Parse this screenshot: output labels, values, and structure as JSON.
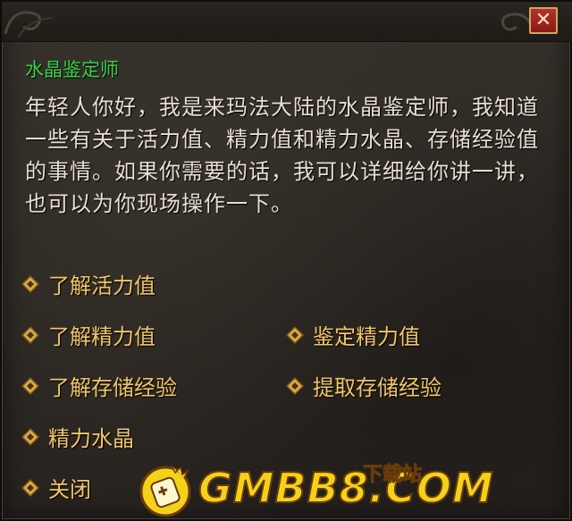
{
  "npc": {
    "name": "水晶鉴定师",
    "dialog": "年轻人你好，我是来玛法大陆的水晶鉴定师，我知道一些有关于活力值、精力值和精力水晶、存储经验值的事情。如果你需要的话，我可以详细给你讲一讲，也可以为你现场操作一下。"
  },
  "options": {
    "learn_vitality": "了解活力值",
    "learn_energy": "了解精力值",
    "appraise_energy": "鉴定精力值",
    "learn_stored_exp": "了解存储经验",
    "extract_stored_exp": "提取存储经验",
    "energy_crystal": "精力水晶",
    "close": "关闭"
  },
  "close_button": {
    "glyph": "✕",
    "icon": "close-icon"
  },
  "watermark": {
    "text": "GMBB8.COM",
    "sub": "下载站"
  },
  "colors": {
    "npc_name": "#39d14a",
    "dialog_text": "#e7dfd0",
    "option_text": "#f0c46a",
    "panel_bg": "#2d2924",
    "close_bg": "#a8281f"
  }
}
